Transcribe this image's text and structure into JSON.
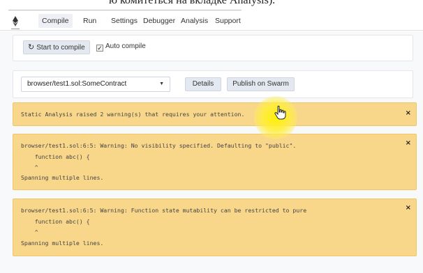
{
  "caption": {
    "text": "ю комитеться на вкладке Analysis)."
  },
  "nav": {
    "logo_icon": "remix-logo-icon",
    "tabs": [
      {
        "label": "Compile",
        "active": true
      },
      {
        "label": "Run",
        "active": false
      },
      {
        "label": "Settings",
        "active": false
      },
      {
        "label": "Debugger",
        "active": false
      },
      {
        "label": "Analysis",
        "active": false
      },
      {
        "label": "Support",
        "active": false
      }
    ]
  },
  "compile": {
    "button_label": "Start to compile",
    "button_icon": "refresh-icon",
    "auto_compile_label": "Auto compile",
    "auto_compile_checked": true
  },
  "contract": {
    "selected": "browser/test1.sol:SomeContract",
    "details_label": "Details",
    "publish_label": "Publish on Swarm"
  },
  "warnings": [
    {
      "lines": [
        "Static Analysis raised 2 warning(s) that requires your attention."
      ]
    },
    {
      "lines": [
        "browser/test1.sol:6:5: Warning: No visibility specified. Defaulting to \"public\".",
        "    function abc() {",
        "    ^",
        "Spanning multiple lines."
      ]
    },
    {
      "lines": [
        "browser/test1.sol:6:5: Warning: Function state mutability can be restricted to pure",
        "    function abc() {",
        "    ^",
        "Spanning multiple lines."
      ]
    }
  ],
  "close_glyph": "×",
  "colors": {
    "warning_bg": "#f8d68a",
    "warning_border": "#efc66c",
    "button_bg": "#e4e8f0",
    "highlight": "#fff200"
  }
}
